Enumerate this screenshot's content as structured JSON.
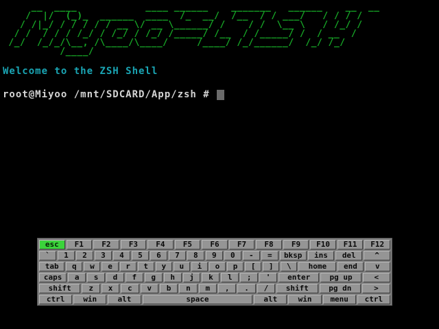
{
  "terminal": {
    "banner": "     __  ____            ____ ______    _______   ______    __  __\n    /  |/  (_)_  ______  ____  /_  __/  /__  / / ___/   / / / /\n   / /|_/ / / / / / __ \\/ __ \\______/ /    / /  \\__ \\   / /_/ / \n  / /  / / / /_/ / /_/ / /_/ /_____/ /__  / /_____/ /  / __  /  \n /_/  /_/_/\\__, /\\____/\\____/     /____/ /_/______/  /_/ /_/   \n          /____/",
    "welcome": "Welcome to the ZSH Shell",
    "prompt": "root@Miyoo /mnt/SDCARD/App/zsh #"
  },
  "keyboard": {
    "selected_key": "esc",
    "rows": [
      [
        {
          "label": "esc",
          "id": "esc"
        },
        {
          "label": "F1",
          "id": "f1"
        },
        {
          "label": "F2",
          "id": "f2"
        },
        {
          "label": "F3",
          "id": "f3"
        },
        {
          "label": "F4",
          "id": "f4"
        },
        {
          "label": "F5",
          "id": "f5"
        },
        {
          "label": "F6",
          "id": "f6"
        },
        {
          "label": "F7",
          "id": "f7"
        },
        {
          "label": "F8",
          "id": "f8"
        },
        {
          "label": "F9",
          "id": "f9"
        },
        {
          "label": "F10",
          "id": "f10"
        },
        {
          "label": "F11",
          "id": "f11"
        },
        {
          "label": "F12",
          "id": "f12"
        }
      ],
      [
        {
          "label": "`",
          "id": "backtick"
        },
        {
          "label": "1",
          "id": "1"
        },
        {
          "label": "2",
          "id": "2"
        },
        {
          "label": "3",
          "id": "3"
        },
        {
          "label": "4",
          "id": "4"
        },
        {
          "label": "5",
          "id": "5"
        },
        {
          "label": "6",
          "id": "6"
        },
        {
          "label": "7",
          "id": "7"
        },
        {
          "label": "8",
          "id": "8"
        },
        {
          "label": "9",
          "id": "9"
        },
        {
          "label": "0",
          "id": "0"
        },
        {
          "label": "-",
          "id": "minus"
        },
        {
          "label": "=",
          "id": "equals"
        },
        {
          "label": "bksp",
          "id": "bksp",
          "w": "w2"
        },
        {
          "label": "ins",
          "id": "ins",
          "w": "w2"
        },
        {
          "label": "del",
          "id": "del",
          "w": "w2"
        },
        {
          "label": "^",
          "id": "up",
          "w": "w2"
        }
      ],
      [
        {
          "label": "tab",
          "id": "tab",
          "w": "w2"
        },
        {
          "label": "q",
          "id": "q"
        },
        {
          "label": "w",
          "id": "w"
        },
        {
          "label": "e",
          "id": "e"
        },
        {
          "label": "r",
          "id": "r"
        },
        {
          "label": "t",
          "id": "t"
        },
        {
          "label": "y",
          "id": "y"
        },
        {
          "label": "u",
          "id": "u"
        },
        {
          "label": "i",
          "id": "i"
        },
        {
          "label": "o",
          "id": "o"
        },
        {
          "label": "p",
          "id": "p"
        },
        {
          "label": "[",
          "id": "lbracket"
        },
        {
          "label": "]",
          "id": "rbracket"
        },
        {
          "label": "\\",
          "id": "backslash"
        },
        {
          "label": "home",
          "id": "home",
          "w": "w3"
        },
        {
          "label": "end",
          "id": "end",
          "w": "w2"
        },
        {
          "label": "v",
          "id": "down",
          "w": "w2"
        }
      ],
      [
        {
          "label": "caps",
          "id": "caps",
          "w": "w2"
        },
        {
          "label": "a",
          "id": "a"
        },
        {
          "label": "s",
          "id": "s"
        },
        {
          "label": "d",
          "id": "d"
        },
        {
          "label": "f",
          "id": "f"
        },
        {
          "label": "g",
          "id": "g"
        },
        {
          "label": "h",
          "id": "h"
        },
        {
          "label": "j",
          "id": "j"
        },
        {
          "label": "k",
          "id": "k"
        },
        {
          "label": "l",
          "id": "l"
        },
        {
          "label": ";",
          "id": "semicolon"
        },
        {
          "label": "'",
          "id": "quote"
        },
        {
          "label": "enter",
          "id": "enter",
          "w": "w3"
        },
        {
          "label": "pg up",
          "id": "pgup",
          "w": "w3"
        },
        {
          "label": "<",
          "id": "left",
          "w": "w2"
        }
      ],
      [
        {
          "label": "shift",
          "id": "lshift",
          "w": "w3"
        },
        {
          "label": "z",
          "id": "z"
        },
        {
          "label": "x",
          "id": "x"
        },
        {
          "label": "c",
          "id": "c"
        },
        {
          "label": "v",
          "id": "v"
        },
        {
          "label": "b",
          "id": "b"
        },
        {
          "label": "n",
          "id": "n"
        },
        {
          "label": "m",
          "id": "m"
        },
        {
          "label": ",",
          "id": "comma"
        },
        {
          "label": ".",
          "id": "period"
        },
        {
          "label": "/",
          "id": "slash"
        },
        {
          "label": "shift",
          "id": "rshift",
          "w": "w3"
        },
        {
          "label": "pg dn",
          "id": "pgdn",
          "w": "w3"
        },
        {
          "label": ">",
          "id": "right",
          "w": "w2"
        }
      ],
      [
        {
          "label": "ctrl",
          "id": "lctrl",
          "w": "w2"
        },
        {
          "label": "win",
          "id": "lwin",
          "w": "w2"
        },
        {
          "label": "alt",
          "id": "lalt",
          "w": "w2"
        },
        {
          "label": "space",
          "id": "space",
          "w": "w5"
        },
        {
          "label": "alt",
          "id": "ralt",
          "w": "w2"
        },
        {
          "label": "win",
          "id": "rwin",
          "w": "w2"
        },
        {
          "label": "menu",
          "id": "menu",
          "w": "w2"
        },
        {
          "label": "ctrl",
          "id": "rctrl",
          "w": "w2"
        }
      ]
    ]
  }
}
